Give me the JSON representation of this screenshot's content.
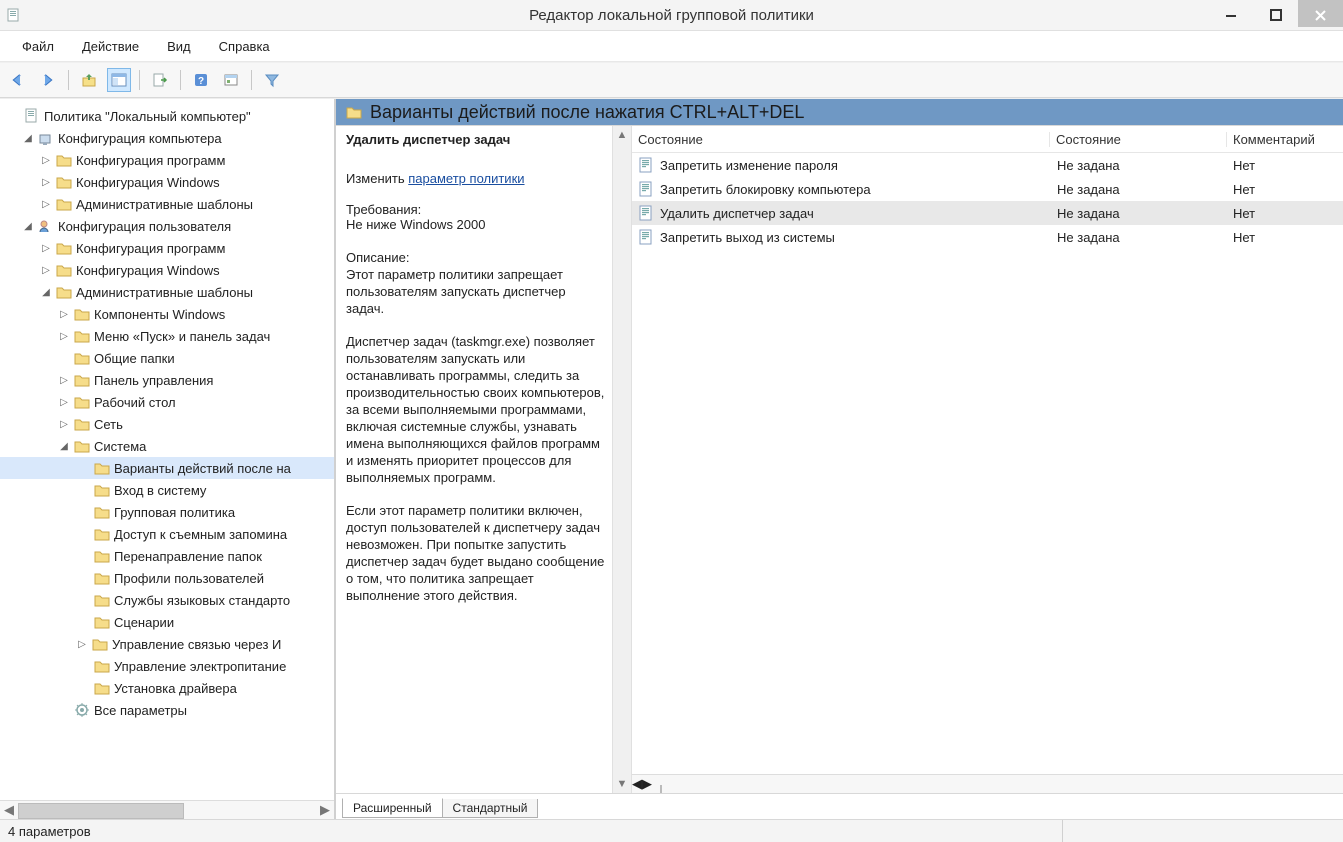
{
  "window": {
    "title": "Редактор локальной групповой политики"
  },
  "menu": {
    "file": "Файл",
    "action": "Действие",
    "view": "Вид",
    "help": "Справка"
  },
  "tree": {
    "root": "Политика \"Локальный компьютер\"",
    "comp_config": "Конфигурация компьютера",
    "comp_prog": "Конфигурация программ",
    "comp_win": "Конфигурация Windows",
    "comp_adm": "Административные шаблоны",
    "user_config": "Конфигурация пользователя",
    "user_prog": "Конфигурация программ",
    "user_win": "Конфигурация Windows",
    "user_adm": "Административные шаблоны",
    "adm_comp": "Компоненты Windows",
    "adm_start": "Меню «Пуск» и панель задач",
    "adm_common": "Общие папки",
    "adm_panel": "Панель управления",
    "adm_desk": "Рабочий стол",
    "adm_net": "Сеть",
    "adm_sys": "Система",
    "sys_cad": "Варианты действий после на",
    "sys_login": "Вход в систему",
    "sys_gp": "Групповая политика",
    "sys_removable": "Доступ к съемным запомина",
    "sys_folder": "Перенаправление папок",
    "sys_profiles": "Профили пользователей",
    "sys_locale": "Службы языковых стандарто",
    "sys_scripts": "Сценарии",
    "sys_comm": "Управление связью через И",
    "sys_power": "Управление электропитание",
    "sys_driver": "Установка драйвера",
    "all_settings": "Все параметры"
  },
  "header": {
    "title": "Варианты действий после нажатия CTRL+ALT+DEL"
  },
  "detail": {
    "title": "Удалить диспетчер задач",
    "edit_label": "Изменить",
    "edit_link": "параметр политики",
    "req_label": "Требования:",
    "req_text": "Не ниже Windows 2000",
    "desc_label": "Описание:",
    "desc_p1": "Этот параметр политики запрещает пользователям запускать диспетчер задач.",
    "desc_p2": "Диспетчер задач (taskmgr.exe) позволяет пользователям запускать или останавливать программы, следить за производительностью своих компьютеров, за всеми выполняемыми программами, включая системные службы, узнавать имена выполняющихся файлов программ и изменять приоритет процессов для выполняемых программ.",
    "desc_p3": "Если этот параметр политики включен, доступ пользователей к диспетчеру задач невозможен. При попытке запустить диспетчер задач будет выдано сообщение о том, что политика запрещает выполнение этого действия."
  },
  "list": {
    "columns": {
      "a": "Состояние",
      "b": "Состояние",
      "c": "Комментарий"
    },
    "rows": [
      {
        "name": "Запретить изменение пароля",
        "state": "Не задана",
        "comment": "Нет"
      },
      {
        "name": "Запретить блокировку компьютера",
        "state": "Не задана",
        "comment": "Нет"
      },
      {
        "name": "Удалить диспетчер задач",
        "state": "Не задана",
        "comment": "Нет",
        "selected": true
      },
      {
        "name": "Запретить выход из системы",
        "state": "Не задана",
        "comment": "Нет"
      }
    ]
  },
  "tabs": {
    "extended": "Расширенный",
    "standard": "Стандартный"
  },
  "status": {
    "text": "4 параметров"
  }
}
